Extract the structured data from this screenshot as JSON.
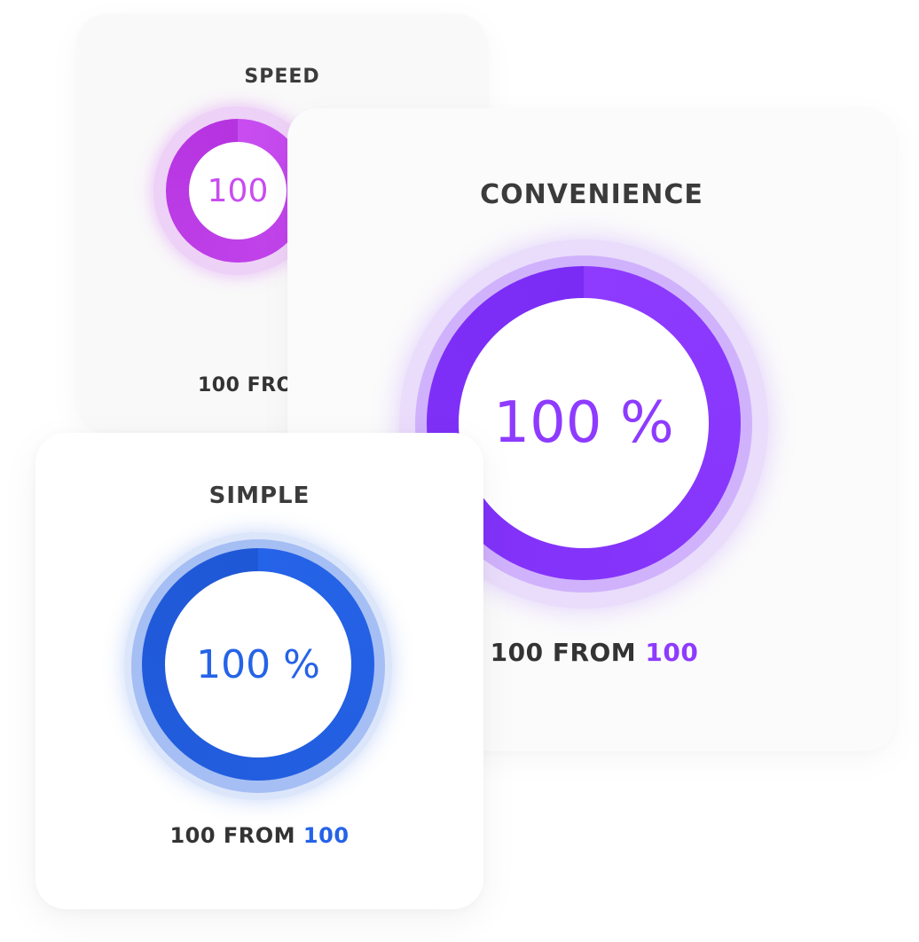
{
  "cards": [
    {
      "id": "speed",
      "title": "SPEED",
      "percent_label": "100",
      "value": 100,
      "max": 100,
      "footer_prefix": "100 FRO",
      "footer_value": "",
      "color": "#c84df0",
      "color_end": "#b533e0"
    },
    {
      "id": "convenience",
      "title": "CONVENIENCE",
      "percent_label": "100 %",
      "value": 100,
      "max": 100,
      "footer_prefix": "100 FROM ",
      "footer_value": "100",
      "color": "#8e3bff",
      "color_end": "#7a2cf5"
    },
    {
      "id": "simple",
      "title": "SIMPLE",
      "percent_label": "100 %",
      "value": 100,
      "max": 100,
      "footer_prefix": "100 FROM ",
      "footer_value": "100",
      "color": "#2563e8",
      "color_end": "#1f58d6"
    }
  ]
}
